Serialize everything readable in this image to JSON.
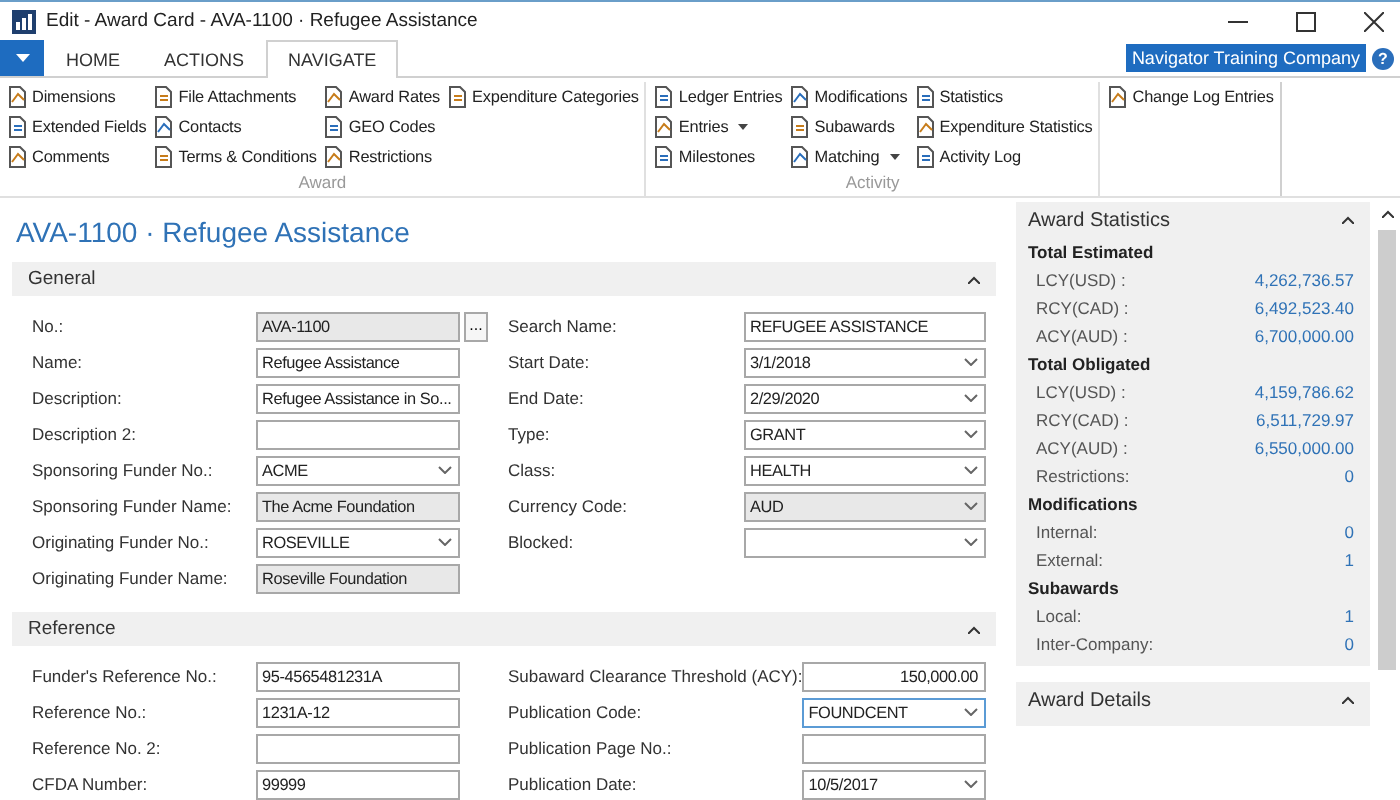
{
  "window": {
    "title": "Edit - Award Card - AVA-1100 · Refugee Assistance"
  },
  "tabs": [
    {
      "label": "HOME",
      "selected": false
    },
    {
      "label": "ACTIONS",
      "selected": false
    },
    {
      "label": "NAVIGATE",
      "selected": true
    }
  ],
  "company": {
    "name": "Navigator Training Company",
    "help": "?"
  },
  "ribbon": [
    {
      "label": "Award",
      "columns": [
        [
          {
            "label": "Dimensions",
            "dropdown": false
          },
          {
            "label": "Extended Fields",
            "dropdown": false
          },
          {
            "label": "Comments",
            "dropdown": false
          }
        ],
        [
          {
            "label": "File Attachments",
            "dropdown": false
          },
          {
            "label": "Contacts",
            "dropdown": false
          },
          {
            "label": "Terms & Conditions",
            "dropdown": false
          }
        ],
        [
          {
            "label": "Award Rates",
            "dropdown": false
          },
          {
            "label": "GEO Codes",
            "dropdown": false
          },
          {
            "label": "Restrictions",
            "dropdown": false
          }
        ],
        [
          {
            "label": "Expenditure Categories",
            "dropdown": false
          }
        ]
      ]
    },
    {
      "label": "Activity",
      "columns": [
        [
          {
            "label": "Ledger Entries",
            "dropdown": false
          },
          {
            "label": "Entries",
            "dropdown": true
          },
          {
            "label": "Milestones",
            "dropdown": false
          }
        ],
        [
          {
            "label": "Modifications",
            "dropdown": false
          },
          {
            "label": "Subawards",
            "dropdown": false
          },
          {
            "label": "Matching",
            "dropdown": true
          }
        ],
        [
          {
            "label": "Statistics",
            "dropdown": false
          },
          {
            "label": "Expenditure Statistics",
            "dropdown": false
          },
          {
            "label": "Activity Log",
            "dropdown": false
          }
        ]
      ]
    },
    {
      "columns": [
        [
          {
            "label": "Change Log Entries",
            "dropdown": false
          }
        ]
      ]
    }
  ],
  "page_title": "AVA-1100 · Refugee Assistance",
  "sections": [
    {
      "title": "General",
      "expanded": true,
      "left": [
        {
          "label": "No.:",
          "value": "AVA-1100",
          "kind": "lookup",
          "button": "...",
          "readonly": true,
          "focused": false
        },
        {
          "label": "Name:",
          "value": "Refugee Assistance",
          "kind": "text",
          "readonly": false,
          "focused": false
        },
        {
          "label": "Description:",
          "value": "Refugee Assistance in So...",
          "kind": "text",
          "readonly": false,
          "focused": false
        },
        {
          "label": "Description 2:",
          "kind": "text",
          "readonly": false,
          "focused": false
        },
        {
          "label": "Sponsoring Funder No.:",
          "value": "ACME",
          "kind": "select",
          "readonly": false,
          "focused": false
        },
        {
          "label": "Sponsoring Funder Name:",
          "value": "The Acme Foundation",
          "kind": "text",
          "readonly": true,
          "focused": false
        },
        {
          "label": "Originating Funder No.:",
          "value": "ROSEVILLE",
          "kind": "select",
          "readonly": false,
          "focused": false
        },
        {
          "label": "Originating Funder Name:",
          "value": "Roseville Foundation",
          "kind": "text",
          "readonly": true,
          "focused": false
        }
      ],
      "right": [
        {
          "label": "Search Name:",
          "value": "REFUGEE ASSISTANCE",
          "kind": "text",
          "readonly": false,
          "focused": false
        },
        {
          "label": "Start Date:",
          "value": "3/1/2018",
          "kind": "select",
          "readonly": false,
          "focused": false
        },
        {
          "label": "End Date:",
          "value": "2/29/2020",
          "kind": "select",
          "readonly": false,
          "focused": false
        },
        {
          "label": "Type:",
          "value": "GRANT",
          "kind": "select",
          "readonly": false,
          "focused": false
        },
        {
          "label": "Class:",
          "value": "HEALTH",
          "kind": "select",
          "readonly": false,
          "focused": false
        },
        {
          "label": "Currency Code:",
          "value": "AUD",
          "kind": "select",
          "readonly": true,
          "focused": false
        },
        {
          "label": "Blocked:",
          "kind": "select",
          "readonly": false,
          "focused": false
        }
      ]
    },
    {
      "title": "Reference",
      "expanded": true,
      "left": [
        {
          "label": "Funder's Reference No.:",
          "value": "95-4565481231A",
          "kind": "text",
          "readonly": false,
          "focused": false
        },
        {
          "label": "Reference No.:",
          "value": "1231A-12",
          "kind": "text",
          "readonly": false,
          "focused": false
        },
        {
          "label": "Reference No. 2:",
          "kind": "text",
          "readonly": false,
          "focused": false
        },
        {
          "label": "CFDA Number:",
          "value": "99999",
          "kind": "text",
          "readonly": false,
          "focused": false
        }
      ],
      "right": [
        {
          "label": "Subaward Clearance Threshold (ACY):",
          "value": "150,000.00",
          "kind": "number",
          "readonly": false,
          "focused": false
        },
        {
          "label": "Publication Code:",
          "value": "FOUNDCENT",
          "kind": "select",
          "readonly": false,
          "focused": true
        },
        {
          "label": "Publication Page No.:",
          "kind": "text",
          "readonly": false,
          "focused": false
        },
        {
          "label": "Publication Date:",
          "value": "10/5/2017",
          "kind": "select",
          "readonly": false,
          "focused": false
        }
      ]
    }
  ],
  "factboxes": [
    {
      "title": "Award Statistics",
      "expanded": true,
      "groups": [
        {
          "heading": "Total Estimated",
          "rows": [
            {
              "label": "LCY(USD) :",
              "value": "4,262,736.57"
            },
            {
              "label": "RCY(CAD) :",
              "value": "6,492,523.40"
            },
            {
              "label": "ACY(AUD) :",
              "value": "6,700,000.00"
            }
          ]
        },
        {
          "heading": "Total Obligated",
          "rows": [
            {
              "label": "LCY(USD) :",
              "value": "4,159,786.62"
            },
            {
              "label": "RCY(CAD) :",
              "value": "6,511,729.97"
            },
            {
              "label": "ACY(AUD) :",
              "value": "6,550,000.00"
            },
            {
              "label": "Restrictions:",
              "value": "0"
            }
          ]
        },
        {
          "heading": "Modifications",
          "rows": [
            {
              "label": "Internal:",
              "value": "0"
            },
            {
              "label": "External:",
              "value": "1"
            }
          ]
        },
        {
          "heading": "Subawards",
          "rows": [
            {
              "label": "Local:",
              "value": "1"
            },
            {
              "label": "Inter-Company:",
              "value": "0"
            }
          ]
        }
      ]
    },
    {
      "title": "Award Details",
      "expanded": true
    }
  ]
}
